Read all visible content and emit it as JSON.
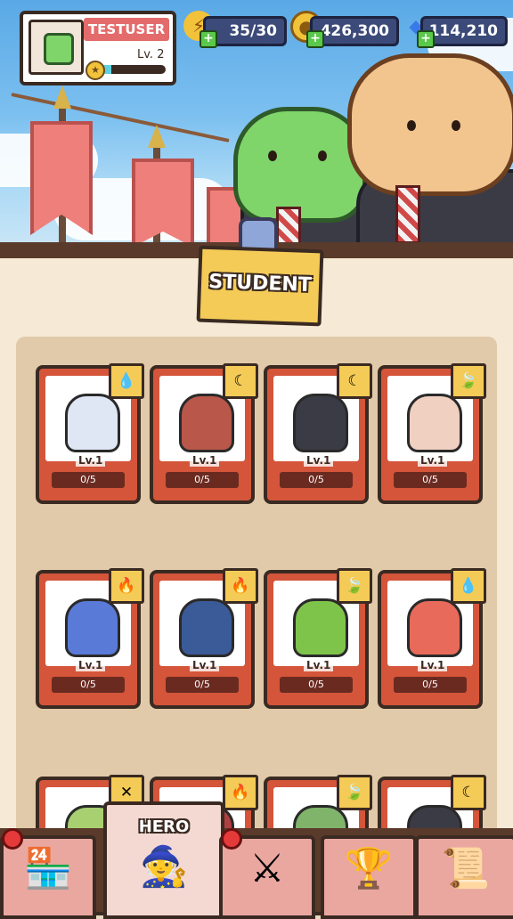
{
  "player": {
    "name": "TESTUSER",
    "level": "Lv. 2",
    "xp_fraction": 0.2
  },
  "resources": [
    {
      "name": "energy",
      "icon": "lightning-icon",
      "value": "35/30"
    },
    {
      "name": "gold",
      "icon": "paw-coin-icon",
      "value": "426,300"
    },
    {
      "name": "gems",
      "icon": "diamond-icon",
      "value": "114,210"
    }
  ],
  "section": {
    "title": "STUDENT"
  },
  "cards": [
    {
      "element": "water",
      "glyph": "💧",
      "level": "Lv.1",
      "count": "0/5",
      "color": "#dfe7f5"
    },
    {
      "element": "moon",
      "glyph": "☾",
      "level": "Lv.1",
      "count": "0/5",
      "color": "#b9574a"
    },
    {
      "element": "moon",
      "glyph": "☾",
      "level": "Lv.1",
      "count": "0/5",
      "color": "#3b3b46"
    },
    {
      "element": "leaf",
      "glyph": "🍃",
      "level": "Lv.1",
      "count": "0/5",
      "color": "#f0d0c0"
    },
    {
      "element": "fire",
      "glyph": "🔥",
      "level": "Lv.1",
      "count": "0/5",
      "color": "#5a7ad8"
    },
    {
      "element": "fire",
      "glyph": "🔥",
      "level": "Lv.1",
      "count": "0/5",
      "color": "#3b5a98"
    },
    {
      "element": "leaf",
      "glyph": "🍃",
      "level": "Lv.1",
      "count": "0/5",
      "color": "#7fc44a"
    },
    {
      "element": "water",
      "glyph": "💧",
      "level": "Lv.1",
      "count": "0/5",
      "color": "#e86a5a"
    },
    {
      "element": "swords",
      "glyph": "✕",
      "level": "",
      "count": "",
      "color": "#a8d070"
    },
    {
      "element": "fire",
      "glyph": "🔥",
      "level": "",
      "count": "",
      "color": "#b04040"
    },
    {
      "element": "leaf",
      "glyph": "🍃",
      "level": "",
      "count": "",
      "color": "#7fb46a"
    },
    {
      "element": "moon",
      "glyph": "☾",
      "level": "",
      "count": "",
      "color": "#3b3b46"
    }
  ],
  "nav": [
    {
      "name": "shop",
      "label": "",
      "glyph": "🏪",
      "notify": true
    },
    {
      "name": "hero",
      "label": "HERO",
      "glyph": "🧙",
      "notify": false,
      "active": true
    },
    {
      "name": "equipment",
      "label": "",
      "glyph": "⚔",
      "notify": true
    },
    {
      "name": "rewards",
      "label": "",
      "glyph": "🏆",
      "notify": false
    },
    {
      "name": "quests",
      "label": "",
      "glyph": "📜",
      "notify": false
    }
  ]
}
